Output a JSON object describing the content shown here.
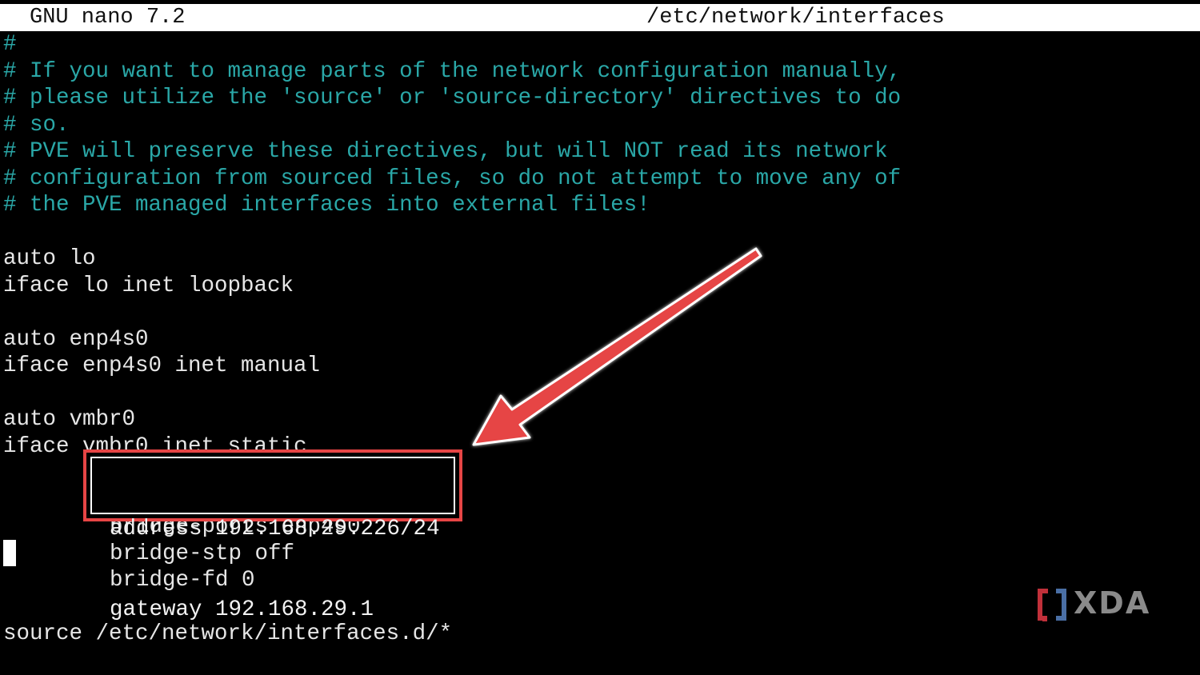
{
  "titlebar": {
    "app_name": "GNU nano 7.2",
    "file_path": "/etc/network/interfaces"
  },
  "editor": {
    "lines": [
      {
        "text": "#",
        "kind": "comment"
      },
      {
        "text": "# If you want to manage parts of the network configuration manually,",
        "kind": "comment"
      },
      {
        "text": "# please utilize the 'source' or 'source-directory' directives to do",
        "kind": "comment"
      },
      {
        "text": "# so.",
        "kind": "comment"
      },
      {
        "text": "# PVE will preserve these directives, but will NOT read its network",
        "kind": "comment"
      },
      {
        "text": "# configuration from sourced files, so do not attempt to move any of",
        "kind": "comment"
      },
      {
        "text": "# the PVE managed interfaces into external files!",
        "kind": "comment"
      },
      {
        "text": "",
        "kind": "blank"
      },
      {
        "text": "auto lo",
        "kind": "code"
      },
      {
        "text": "iface lo inet loopback",
        "kind": "code"
      },
      {
        "text": "",
        "kind": "blank"
      },
      {
        "text": "auto enp4s0",
        "kind": "code"
      },
      {
        "text": "iface enp4s0 inet manual",
        "kind": "code"
      },
      {
        "text": "",
        "kind": "blank"
      },
      {
        "text": "auto vmbr0",
        "kind": "code"
      },
      {
        "text": "iface vmbr0 inet static",
        "kind": "code"
      },
      {
        "text": "address 192.168.29.226/24",
        "kind": "indent"
      },
      {
        "text": "gateway 192.168.29.1",
        "kind": "indent"
      },
      {
        "text": "bridge-ports enp4s0",
        "kind": "indent"
      },
      {
        "text": "bridge-stp off",
        "kind": "indent"
      },
      {
        "text": "bridge-fd 0",
        "kind": "indent"
      },
      {
        "text": "",
        "kind": "blank"
      },
      {
        "text": "source /etc/network/interfaces.d/*",
        "kind": "code"
      }
    ]
  },
  "highlight": {
    "address_line": "address 192.168.29.226/24",
    "gateway_line": "gateway 192.168.29.1",
    "color": "#e64545"
  },
  "watermark": {
    "brand": "XDA"
  },
  "colors": {
    "comment": "#2aa7a7",
    "text": "#e6e6e6",
    "background": "#000000",
    "titlebar": "#ffffff",
    "arrow": "#e64545"
  }
}
